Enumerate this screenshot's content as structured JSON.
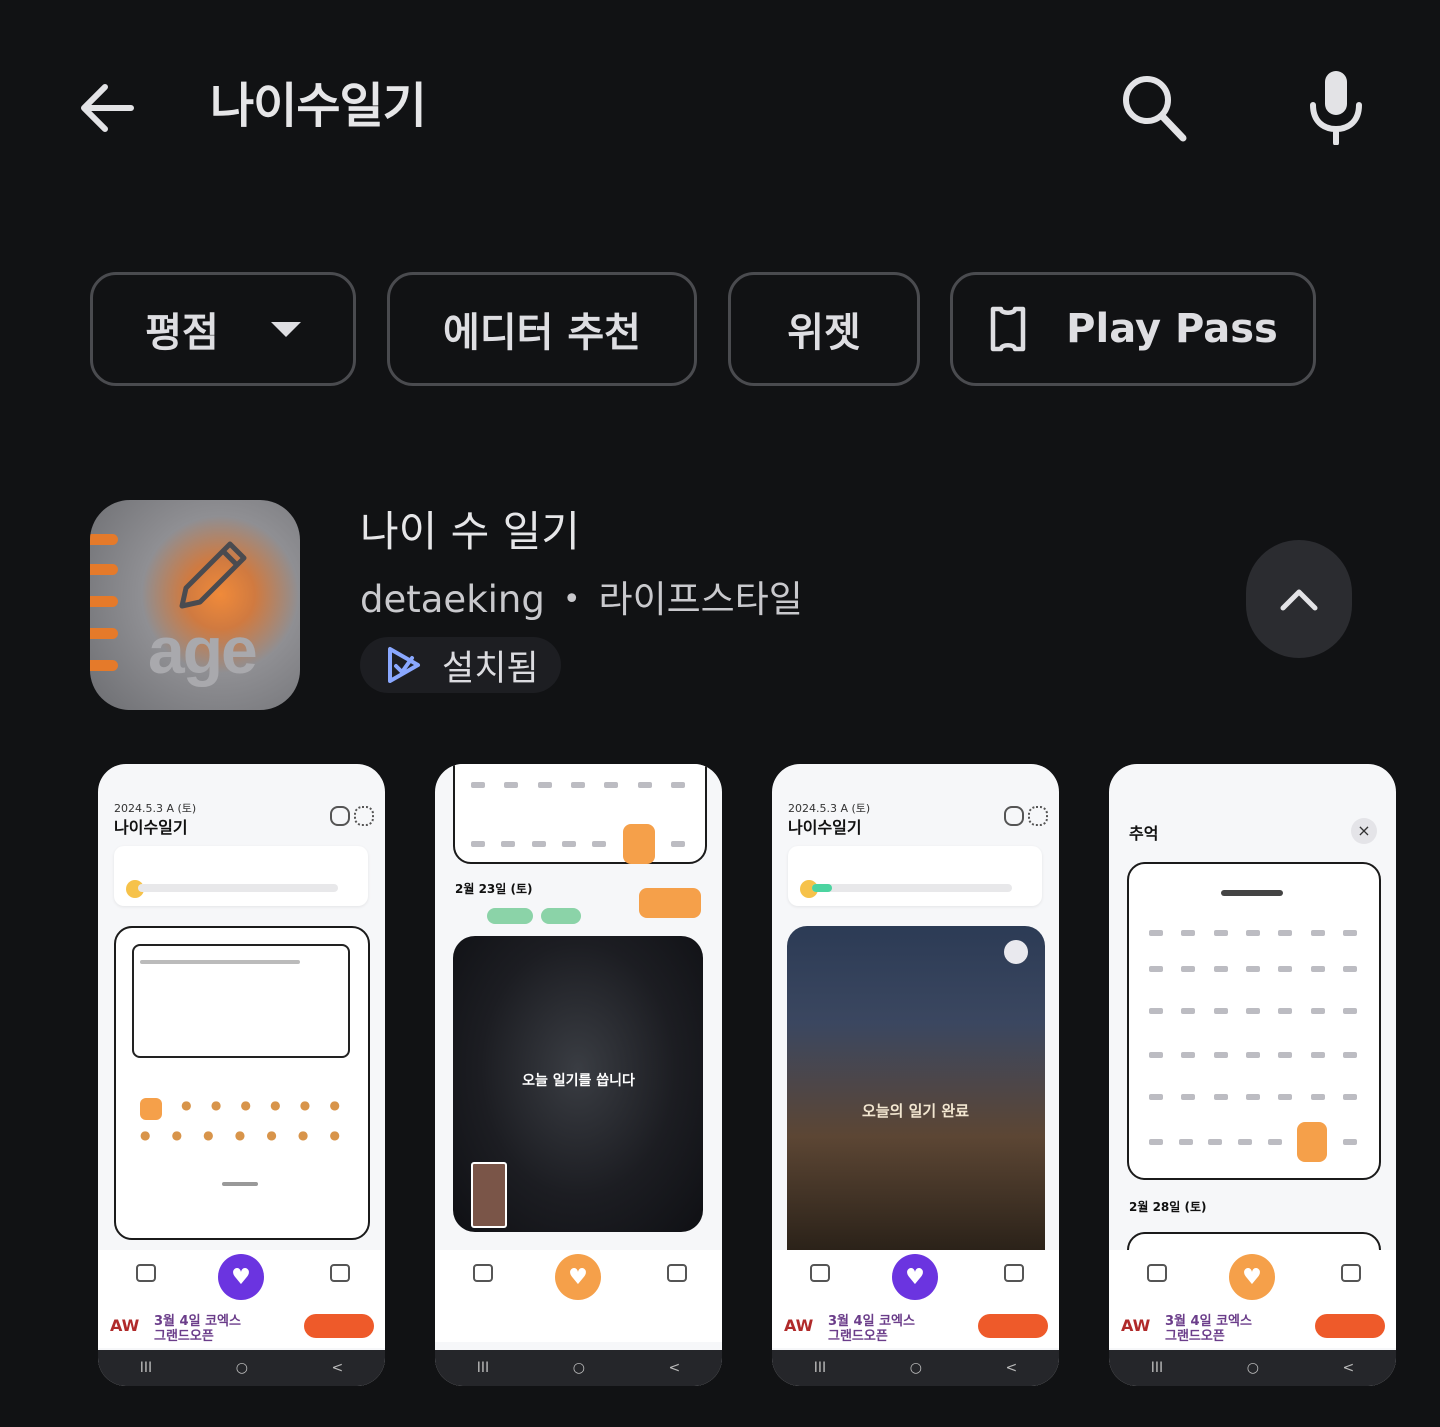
{
  "search": {
    "query": "나이수일기"
  },
  "filters": {
    "rating": "평점",
    "editor_pick": "에디터 추천",
    "widget": "위젯",
    "play_pass": "Play Pass"
  },
  "app": {
    "name": "나이 수 일기",
    "developer": "detaeking",
    "separator": "•",
    "category": "라이프스타일",
    "status": "설치됨",
    "icon_text": "age"
  },
  "colors": {
    "background": "#111214",
    "chip_border": "#4a4b4f",
    "accent_orange": "#f5a04a",
    "accent_purple": "#6b34e0"
  },
  "screenshots": {
    "s1": {
      "date": "2024.5.3 A (토)",
      "title": "나이수일기",
      "ad_line1": "3월 4일 코엑스",
      "ad_line2": "그랜드오픈"
    },
    "s2": {
      "date": "2월 23일 (토)",
      "overlay": "오늘 일기를 씁니다"
    },
    "s3": {
      "date": "2024.5.3 A (토)",
      "title": "나이수일기",
      "overlay": "오늘의 일기 완료",
      "ad_line1": "3월 4일 코엑스",
      "ad_line2": "그랜드오픈"
    },
    "s4": {
      "title": "추억",
      "close": "×",
      "date": "2월 28일 (토)",
      "ad_line1": "3월 4일 코엑스",
      "ad_line2": "그랜드오픈"
    }
  }
}
